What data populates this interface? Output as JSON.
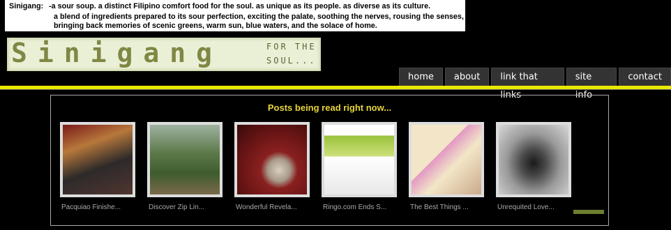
{
  "definition": {
    "term": "Sinigang:",
    "line1": "-a sour soup.  a distinct Filipino comfort food for the soul. as unique as its people. as diverse as its culture.",
    "line2": "a blend of ingredients prepared to its sour perfection, exciting the palate, soothing the nerves, rousing the senses,",
    "line3": "bringing back memories of scenic greens, warm sun, blue waters, and the solace of home."
  },
  "logo": {
    "title": "Sinigang",
    "subtitle": "FOR THE SOUL..."
  },
  "nav": [
    "home",
    "about",
    "link that links",
    "site info",
    "contact"
  ],
  "panel": {
    "heading": "Posts being read right now...",
    "posts": [
      "Pacquiao Finishe...",
      "Discover Zip Lin...",
      "Wonderful Revela...",
      "Ringo.com Ends S...",
      "The Best Things ...",
      "Unrequited Love..."
    ]
  },
  "colors": {
    "accent_bar": "#e8e800",
    "heading": "#e8d43a"
  }
}
